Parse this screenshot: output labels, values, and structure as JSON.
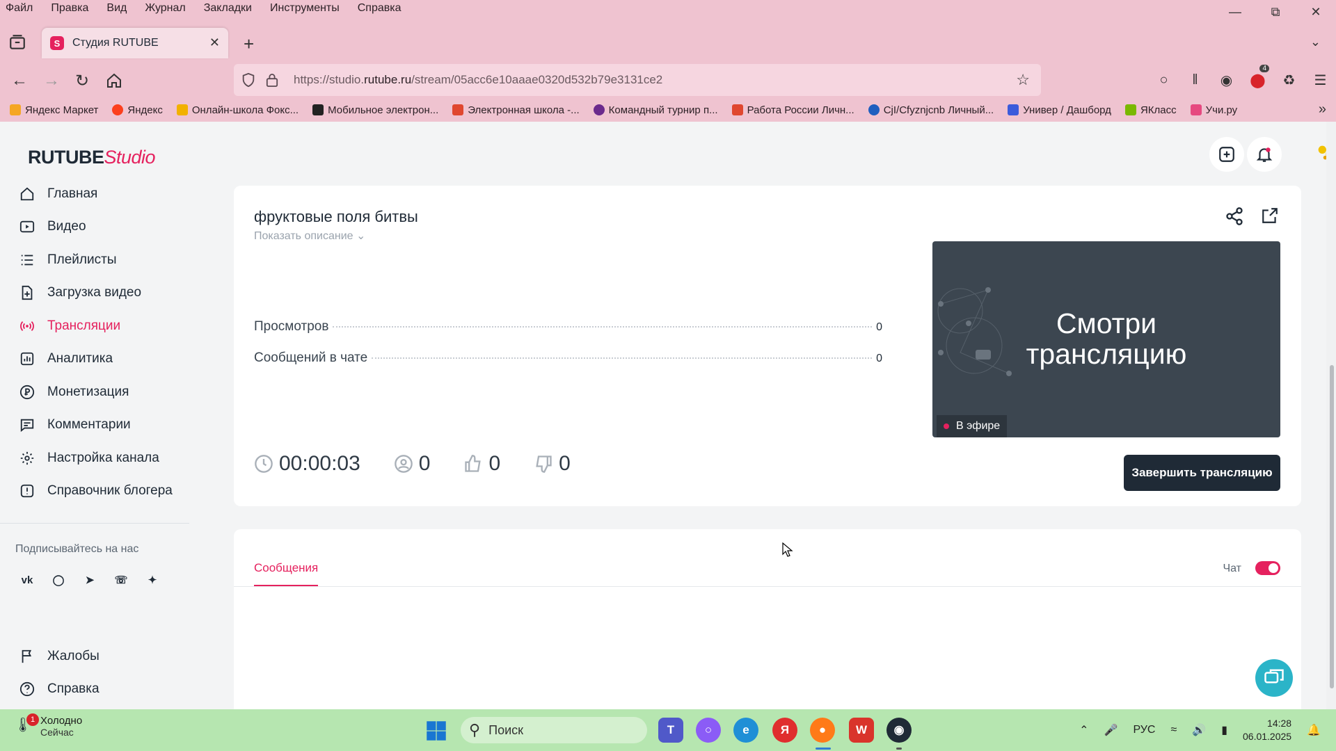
{
  "browser": {
    "menu": [
      "Файл",
      "Правка",
      "Вид",
      "Журнал",
      "Закладки",
      "Инструменты",
      "Справка"
    ],
    "tab_title": "Студия RUTUBE",
    "url_prefix": "https://studio.",
    "url_domain": "rutube.ru",
    "url_path": "/stream/05acc6e10aaae0320d532b79e3131ce2",
    "extension_badge": "4",
    "bookmarks": [
      {
        "label": "Яндекс Маркет",
        "color": "#f5a623"
      },
      {
        "label": "Яндекс",
        "color": "#fc3f1d"
      },
      {
        "label": "Онлайн-школа Фокс...",
        "color": "#f2b100"
      },
      {
        "label": "Мобильное электрон...",
        "color": "#222222"
      },
      {
        "label": "Электронная школа -...",
        "color": "#e0472f"
      },
      {
        "label": "Командный турнир п...",
        "color": "#6b2a8c"
      },
      {
        "label": "Работа России Личн...",
        "color": "#e0472f"
      },
      {
        "label": "CjI/Cfyznjcnb Личный...",
        "color": "#1f5fbf"
      },
      {
        "label": "Универ / Дашборд",
        "color": "#3b5bdb"
      },
      {
        "label": "ЯКласс",
        "color": "#7ab800"
      },
      {
        "label": "Учи.ру",
        "color": "#e64980"
      }
    ]
  },
  "app": {
    "logo_main": "RUTUBE",
    "logo_studio": "Studio",
    "nav": [
      {
        "label": "Главная",
        "icon": "home-icon",
        "active": false
      },
      {
        "label": "Видео",
        "icon": "video-icon",
        "active": false
      },
      {
        "label": "Плейлисты",
        "icon": "playlist-icon",
        "active": false
      },
      {
        "label": "Загрузка видео",
        "icon": "upload-icon",
        "active": false
      },
      {
        "label": "Трансляции",
        "icon": "broadcast-icon",
        "active": true
      },
      {
        "label": "Аналитика",
        "icon": "analytics-icon",
        "active": false
      },
      {
        "label": "Монетизация",
        "icon": "ruble-icon",
        "active": false
      },
      {
        "label": "Комментарии",
        "icon": "comment-icon",
        "active": false
      },
      {
        "label": "Настройка канала",
        "icon": "gear-icon",
        "active": false
      },
      {
        "label": "Справочник блогера",
        "icon": "info-icon",
        "active": false
      }
    ],
    "follow_label": "Подписывайтесь на нас",
    "socials": [
      "vk-icon",
      "ok-icon",
      "telegram-icon",
      "viber-icon",
      "dzen-icon"
    ],
    "bottom_nav": [
      {
        "label": "Жалобы",
        "icon": "flag-icon"
      },
      {
        "label": "Справка",
        "icon": "help-icon"
      }
    ],
    "stream": {
      "title": "фруктовые поля битвы",
      "show_description": "Показать описание",
      "stats": [
        {
          "label": "Просмотров",
          "value": "0"
        },
        {
          "label": "Сообщений в чате",
          "value": "0"
        }
      ],
      "preview_text_line1": "Смотри",
      "preview_text_line2": "трансляцию",
      "live_label": "В эфире",
      "duration": "00:00:03",
      "viewers": "0",
      "likes": "0",
      "dislikes": "0",
      "end_button": "Завершить трансляцию"
    },
    "chat": {
      "tab_messages": "Сообщения",
      "chat_label": "Чат",
      "chat_enabled": true
    },
    "accent_color": "#e5215e"
  },
  "taskbar": {
    "weather_title": "Холодно",
    "weather_sub": "Сейчас",
    "notification_count": "1",
    "search_label": "Поиск",
    "language": "РУС",
    "time": "14:28",
    "date": "06.01.2025"
  }
}
